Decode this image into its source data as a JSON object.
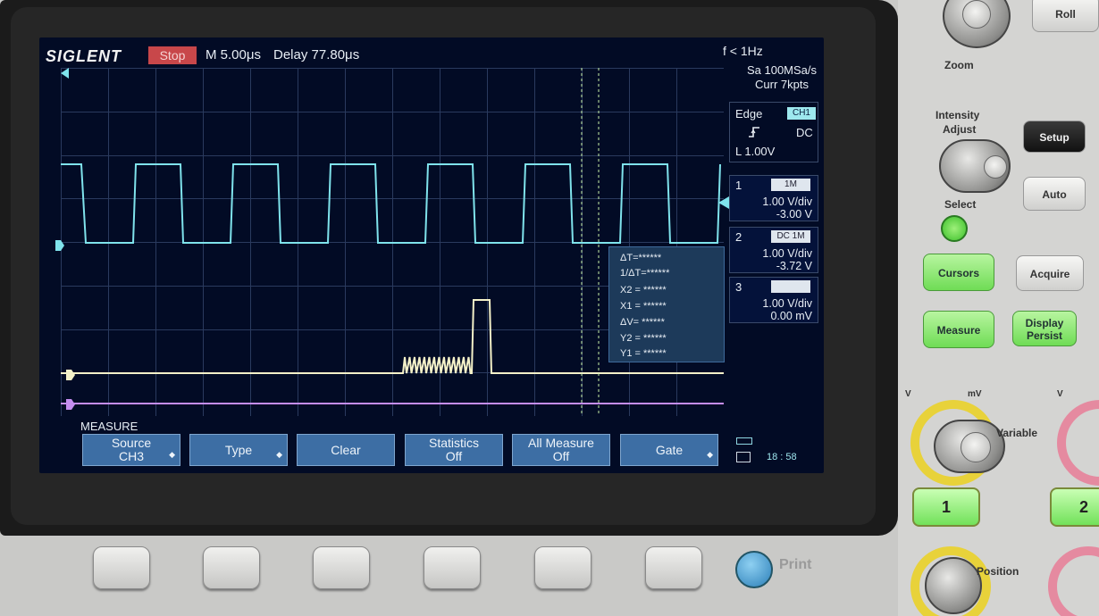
{
  "header": {
    "brand": "SIGLENT",
    "run_state": "Stop",
    "timebase": "M 5.00μs",
    "delay": "Delay 77.80μs",
    "freq": "f < 1Hz"
  },
  "acquisition": {
    "sample_rate": "Sa 100MSa/s",
    "memory": "Curr 7kpts"
  },
  "trigger": {
    "type": "Edge",
    "source": "CH1",
    "slope_icon": "rising-edge-icon",
    "coupling": "DC",
    "level": "L   1.00V"
  },
  "channels": [
    {
      "num": "1",
      "coupling": "1M",
      "scale": "1.00 V/div",
      "offset": "-3.00 V",
      "color": "#7fe3ec"
    },
    {
      "num": "2",
      "coupling": "DC 1M",
      "scale": "1.00 V/div",
      "offset": "-3.72 V",
      "color": "#f4f1c8"
    },
    {
      "num": "3",
      "coupling": "",
      "scale": "1.00 V/div",
      "offset": "0.00 mV",
      "color": "#c58df0"
    }
  ],
  "cursor_readout": {
    "dt": "ΔT=******",
    "inv_dt": "1/ΔT=******",
    "x2": "X2 = ******",
    "x1": "X1 = ******",
    "dv": "ΔV= ******",
    "y2": "Y2 = ******",
    "y1": "Y1 = ******"
  },
  "menu": {
    "title": "MEASURE",
    "keys": [
      {
        "line1": "Source",
        "line2": "CH3"
      },
      {
        "line1": "Type",
        "line2": ""
      },
      {
        "line1": "Clear",
        "line2": ""
      },
      {
        "line1": "Statistics",
        "line2": "Off"
      },
      {
        "line1": "All Measure",
        "line2": "Off"
      },
      {
        "line1": "Gate",
        "line2": ""
      }
    ]
  },
  "status": {
    "time": "18 : 58"
  },
  "front_panel": {
    "roll": "Roll",
    "zoom": "Zoom",
    "intensity": "Intensity",
    "adjust": "Adjust",
    "select": "Select",
    "setup": "Setup",
    "auto": "Auto",
    "cursors": "Cursors",
    "acquire": "Acquire",
    "measure": "Measure",
    "display": "Display",
    "persist": "Persist",
    "variable": "Variable",
    "v_left": "V",
    "mv_right": "mV",
    "v_right": "V",
    "ch1": "1",
    "ch2": "2",
    "position": "Position",
    "print": "Print"
  },
  "waveforms": {
    "ch1_color": "#7fe3ec",
    "ch2_color": "#f4f1c8",
    "ch3_color": "#c58df0",
    "grid_color": "#2a3a5e",
    "cursor_color": "#c9f1a8"
  }
}
